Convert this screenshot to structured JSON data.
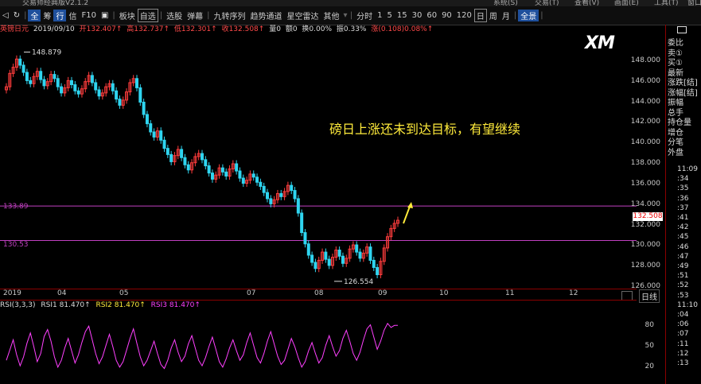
{
  "titlebar": {
    "left": "交易师经典版V2.1.2",
    "right": [
      "系统(S)",
      "交易(T)",
      "查看(V)",
      "画面(E)",
      "工具(T)",
      "窗口"
    ]
  },
  "toolbar": {
    "items": [
      "全",
      "筹",
      "行",
      "信",
      "F10",
      "板块",
      "自选",
      "选股",
      "弹幕",
      "九转序列",
      "趋势通道",
      "星空雷达",
      "其他"
    ],
    "periods": [
      "分时",
      "1",
      "5",
      "15",
      "30",
      "60",
      "90",
      "120",
      "日",
      "周",
      "月"
    ],
    "active_period": "日",
    "badge": "全景"
  },
  "infobar": {
    "name": "英镑日元",
    "date": "2019/09/10",
    "open": "开132.407↑",
    "high": "高132.737↑",
    "low": "低132.301↑",
    "close": "收132.508↑",
    "vol": "量0",
    "amt": "额0",
    "turnover": "换0.00%",
    "amplitude": "振0.33%",
    "change": "涨(0.108)0.08%↑"
  },
  "annotation": "磅日上涨还未到达目标，有望继续",
  "logo": "XM",
  "chart_data": {
    "type": "candlestick",
    "y_ticks": [
      "148.000",
      "146.000",
      "144.000",
      "142.000",
      "140.000",
      "138.000",
      "136.000",
      "134.000",
      "132.000",
      "130.000",
      "128.000",
      "126.000"
    ],
    "x_ticks": [
      "2019",
      "04",
      "05",
      "07",
      "08",
      "09",
      "10",
      "11",
      "12"
    ],
    "ylim": [
      126,
      150
    ],
    "high_label": "148.879",
    "low_label": "126.554",
    "hlines": [
      {
        "label": "133.89",
        "value": 133.89
      },
      {
        "label": "130.53",
        "value": 130.53
      }
    ],
    "last_price": "132.508",
    "series": [
      145.5,
      146.8,
      147.4,
      148.2,
      147.6,
      146.9,
      146.1,
      145.8,
      146.5,
      147.0,
      146.2,
      145.6,
      146.0,
      146.7,
      146.3,
      145.5,
      144.9,
      145.4,
      146.1,
      145.7,
      145.1,
      144.8,
      145.3,
      146.0,
      146.6,
      145.9,
      145.2,
      144.6,
      144.9,
      145.5,
      145.8,
      145.1,
      144.3,
      143.7,
      144.2,
      145.0,
      145.9,
      146.3,
      145.4,
      144.0,
      142.8,
      141.9,
      141.1,
      140.6,
      141.2,
      140.3,
      139.5,
      138.9,
      138.2,
      138.8,
      139.4,
      138.6,
      137.9,
      137.4,
      138.1,
      138.7,
      139.0,
      138.4,
      137.8,
      137.1,
      136.5,
      136.9,
      137.6,
      137.2,
      136.8,
      137.5,
      138.0,
      137.3,
      136.6,
      136.1,
      136.4,
      137.0,
      136.7,
      136.2,
      135.8,
      135.2,
      134.6,
      134.1,
      134.5,
      135.1,
      134.8,
      135.3,
      135.9,
      135.4,
      134.6,
      133.2,
      131.3,
      130.2,
      129.1,
      128.4,
      127.8,
      128.6,
      129.4,
      128.7,
      128.1,
      128.9,
      129.6,
      129.0,
      128.3,
      128.8,
      129.7,
      130.1,
      129.4,
      128.8,
      129.3,
      129.9,
      128.6,
      127.9,
      127.2,
      128.5,
      129.8,
      130.9,
      131.7,
      132.2,
      132.5
    ],
    "rsi_head": {
      "label": "RSI(3,3,3)",
      "rsi1": "RSI1 81.470↑",
      "rsi2": "RSI2 81.470↑",
      "rsi3": "RSI3 81.470↑"
    },
    "rsi_ticks": [
      "80",
      "50",
      "20"
    ],
    "rsi_values": [
      30,
      45,
      60,
      38,
      22,
      35,
      55,
      70,
      50,
      28,
      40,
      65,
      75,
      58,
      35,
      20,
      30,
      48,
      62,
      44,
      26,
      38,
      56,
      72,
      80,
      60,
      40,
      25,
      35,
      52,
      68,
      50,
      30,
      20,
      28,
      45,
      62,
      76,
      55,
      35,
      22,
      30,
      44,
      58,
      40,
      24,
      18,
      30,
      48,
      60,
      42,
      28,
      36,
      54,
      66,
      48,
      30,
      22,
      34,
      50,
      64,
      46,
      28,
      20,
      32,
      48,
      60,
      44,
      30,
      38,
      56,
      70,
      52,
      34,
      26,
      40,
      58,
      72,
      54,
      36,
      24,
      30,
      46,
      62,
      50,
      34,
      20,
      28,
      44,
      56,
      40,
      26,
      34,
      52,
      66,
      50,
      36,
      44,
      62,
      74,
      58,
      40,
      30,
      42,
      60,
      76,
      82,
      64,
      46,
      58,
      74,
      84,
      78,
      81,
      81
    ]
  },
  "right_panel": {
    "items": [
      "委比",
      "卖①",
      "买①",
      "最新",
      "涨跌[结]",
      "涨幅[结]",
      "振幅",
      "总手",
      "持仓量",
      "增仓",
      "分笔",
      "外盘"
    ],
    "times": [
      "11:09",
      ":34",
      ":35",
      ":36",
      ":37",
      ":41",
      ":42",
      ":45",
      ":46",
      ":47",
      ":49",
      ":51",
      ":52",
      ":53",
      "11:10",
      ":04",
      ":06",
      ":07",
      ":11",
      ":12",
      ":13"
    ],
    "tab": "日线"
  }
}
